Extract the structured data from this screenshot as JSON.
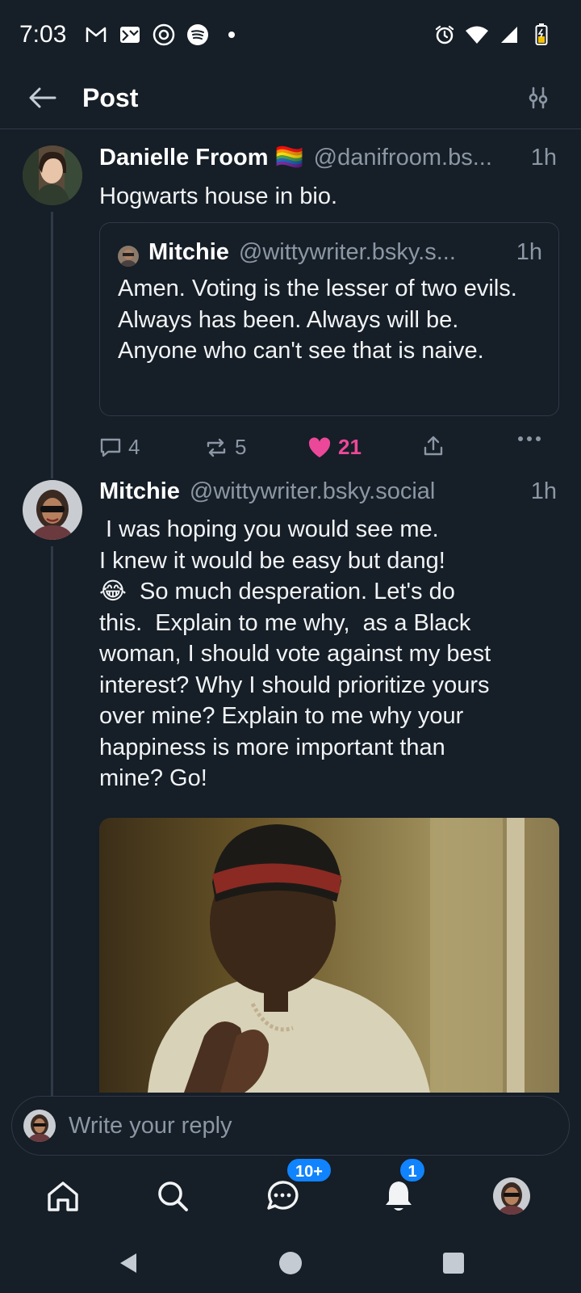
{
  "status_bar": {
    "time": "7:03",
    "left_icons": [
      "gmail-icon",
      "app-icon",
      "threads-icon",
      "spotify-icon",
      "dot-icon"
    ],
    "right_icons": [
      "alarm-icon",
      "wifi-icon",
      "signal-icon",
      "battery-icon"
    ]
  },
  "header": {
    "title": "Post"
  },
  "main_post": {
    "author_name": "Danielle Froom 🏳️‍🌈",
    "handle": "@danifroom.bs...",
    "time": "1h",
    "text": "Hogwarts house in bio.",
    "quote": {
      "author_name": "Mitchie",
      "handle": "@wittywriter.bsky.s...",
      "time": "1h",
      "text": "Amen. Voting is the lesser of two evils. Always has been. Always will be. Anyone who can't see that is naive."
    },
    "actions": {
      "replies": "4",
      "reposts": "5",
      "likes": "21"
    }
  },
  "reply_post": {
    "author_name": "Mitchie",
    "handle": "@wittywriter.bsky.social",
    "time": "1h",
    "text_lines": [
      " I was hoping you would see me.",
      "I knew it would be easy but dang!",
      "😂  So much desperation. Let's do",
      "this.  Explain to me why,  as a Black",
      "woman, I should vote against my best",
      "interest? Why I should prioritize yours",
      "over mine? Explain to me why your",
      "happiness is more important than",
      "mine? Go!"
    ]
  },
  "reply_bar": {
    "placeholder": "Write your reply"
  },
  "bottom_nav": {
    "chat_badge": "10+",
    "notifications_badge": "1"
  },
  "colors": {
    "background": "#161e27",
    "border": "#2e3a47",
    "muted_text": "#8b97a5",
    "like": "#ec4899",
    "badge": "#1083fe"
  }
}
